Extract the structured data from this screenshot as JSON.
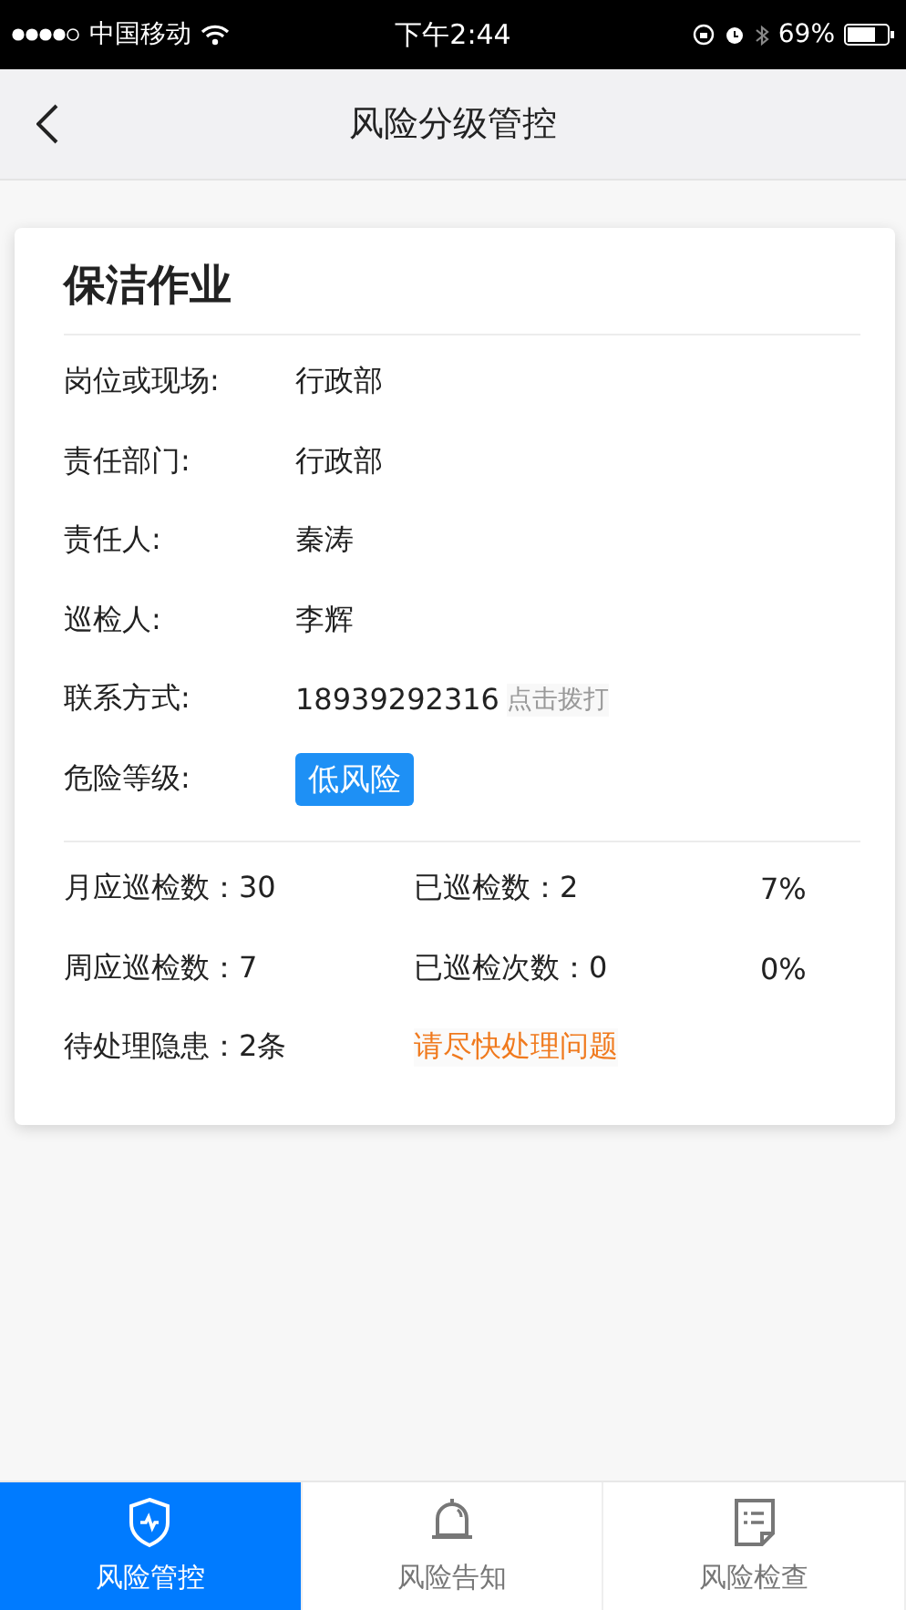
{
  "status_bar": {
    "carrier": "中国移动",
    "time": "下午2:44",
    "battery": "69%"
  },
  "nav": {
    "title": "风险分级管控"
  },
  "card": {
    "title": "保洁作业",
    "fields": [
      {
        "kind": "text",
        "label": "岗位或现场:",
        "value": "行政部"
      },
      {
        "kind": "text",
        "label": "责任部门:",
        "value": "行政部"
      },
      {
        "kind": "text",
        "label": "责任人:",
        "value": "秦涛"
      },
      {
        "kind": "text",
        "label": "巡检人:",
        "value": "李辉"
      },
      {
        "kind": "phone",
        "label": "联系方式:",
        "value": "18939292316",
        "action": "点击拨打"
      },
      {
        "kind": "badge",
        "label": "危险等级:",
        "value": "低风险",
        "color": "#1e90f5"
      }
    ],
    "stats": [
      {
        "a": "月应巡检数：30",
        "b": "已巡检数：2",
        "c": "7%"
      },
      {
        "a": "周应巡检数：7",
        "b": "已巡检次数：0",
        "c": "0%"
      }
    ],
    "pending": {
      "label": "待处理隐患：2条",
      "warning": "请尽快处理问题"
    }
  },
  "tabs": [
    {
      "label": "风险管控",
      "kind": "shield",
      "selected": true
    },
    {
      "label": "风险告知",
      "kind": "bell",
      "selected": false
    },
    {
      "label": "风险检查",
      "kind": "doc",
      "selected": false
    }
  ]
}
